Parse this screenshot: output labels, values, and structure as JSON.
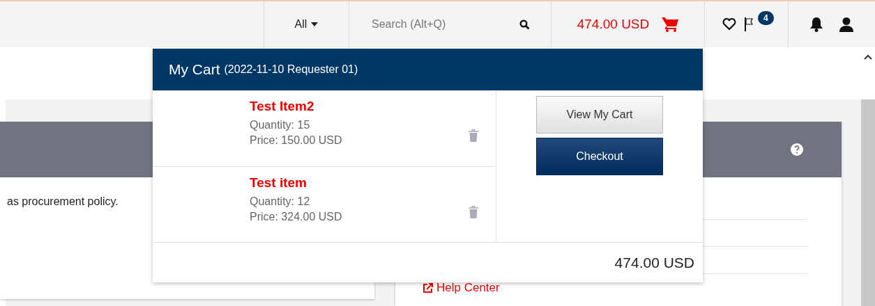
{
  "header": {
    "search_scope": "All",
    "search": {
      "placeholder": "Search (Alt+Q)"
    },
    "cart_total": "474.00 USD",
    "alerts_badge": "4"
  },
  "page": {
    "left_panel": {
      "text": "as procurement policy."
    },
    "right_panel": {
      "link": "Help Center"
    }
  },
  "cart": {
    "title": "My Cart",
    "subtitle": "(2022-11-10 Requester 01)",
    "items": [
      {
        "name": "Test Item2",
        "quantity": "Quantity: 15",
        "price": "Price: 150.00 USD"
      },
      {
        "name": "Test item",
        "quantity": "Quantity: 12",
        "price": "Price: 324.00 USD"
      }
    ],
    "buttons": [
      {
        "label": "View My Cart",
        "kind": "secondary"
      },
      {
        "label": "Checkout",
        "kind": "primary"
      }
    ],
    "total": "474.00 USD"
  }
}
